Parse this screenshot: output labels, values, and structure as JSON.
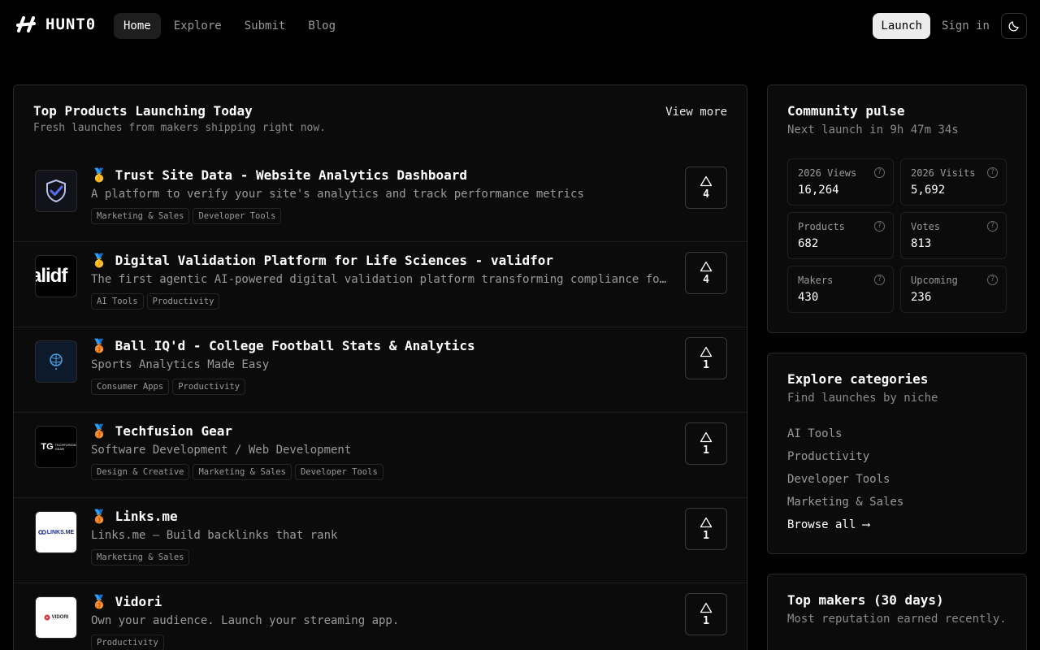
{
  "brand": {
    "name": "HUNT0"
  },
  "nav": {
    "links": [
      "Home",
      "Explore",
      "Submit",
      "Blog"
    ],
    "launch": "Launch",
    "signin": "Sign in"
  },
  "main": {
    "title": "Top Products Launching Today",
    "subtitle": "Fresh launches from makers shipping right now.",
    "view_more": "View more",
    "products": [
      {
        "medal": "🥇",
        "name": "Trust Site Data - Website Analytics Dashboard",
        "desc": "A platform to verify your site's analytics and track performance metrics",
        "tags": [
          "Marketing & Sales",
          "Developer Tools"
        ],
        "votes": "4",
        "icon": "shield-check-logo"
      },
      {
        "medal": "🥇",
        "name": "Digital Validation Platform for Life Sciences - validfor",
        "desc": "The first agentic AI-powered digital validation platform transforming compliance for life sciences",
        "tags": [
          "AI Tools",
          "Productivity"
        ],
        "votes": "4",
        "icon": "validfor-logo",
        "logo_text": "alidf"
      },
      {
        "medal": "🥉",
        "name": "Ball IQ'd - College Football Stats & Analytics",
        "desc": "Sports Analytics Made Easy",
        "tags": [
          "Consumer Apps",
          "Productivity"
        ],
        "votes": "1",
        "icon": "brain-logo"
      },
      {
        "medal": "🥉",
        "name": "Techfusion Gear",
        "desc": "Software Development / Web Development",
        "tags": [
          "Design & Creative",
          "Marketing & Sales",
          "Developer Tools"
        ],
        "votes": "1",
        "icon": "techfusion-logo",
        "logo_text": "TECHFUSION GEAR"
      },
      {
        "medal": "🥉",
        "name": "Links.me",
        "desc": "Links.me — Build backlinks that rank",
        "tags": [
          "Marketing & Sales"
        ],
        "votes": "1",
        "icon": "linksme-logo",
        "logo_text": "LINKS.ME"
      },
      {
        "medal": "🥉",
        "name": "Vidori",
        "desc": "Own your audience. Launch your streaming app.",
        "tags": [
          "Productivity"
        ],
        "votes": "1",
        "icon": "vidori-logo",
        "logo_text": "VIDORI"
      }
    ]
  },
  "pulse": {
    "title": "Community pulse",
    "subtitle": "Next launch in 9h 47m 34s",
    "stats": [
      {
        "label": "2026 Views",
        "value": "16,264"
      },
      {
        "label": "2026 Visits",
        "value": "5,692"
      },
      {
        "label": "Products",
        "value": "682"
      },
      {
        "label": "Votes",
        "value": "813"
      },
      {
        "label": "Makers",
        "value": "430"
      },
      {
        "label": "Upcoming",
        "value": "236"
      }
    ]
  },
  "categories": {
    "title": "Explore categories",
    "subtitle": "Find launches by niche",
    "items": [
      "AI Tools",
      "Productivity",
      "Developer Tools",
      "Marketing & Sales"
    ],
    "browse_all": "Browse all ⟶"
  },
  "makers": {
    "title": "Top makers (30 days)",
    "subtitle": "Most reputation earned recently."
  }
}
